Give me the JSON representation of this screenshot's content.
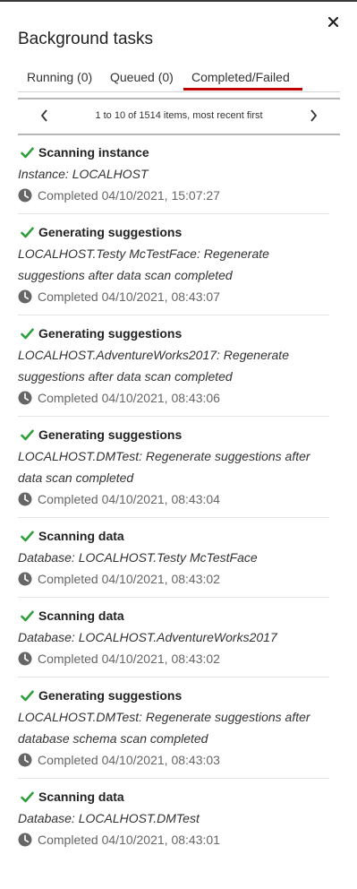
{
  "panel": {
    "title": "Background tasks",
    "close_label": "×"
  },
  "tabs": [
    {
      "label": "Running (0)"
    },
    {
      "label": "Queued (0)"
    },
    {
      "label": "Completed/Failed",
      "active": true
    }
  ],
  "pager": {
    "info": "1 to 10 of 1514 items, most recent first",
    "prev_icon": "chevron-left-icon",
    "next_icon": "chevron-right-icon"
  },
  "colors": {
    "accent": "#c00000",
    "success": "#2e9e3a",
    "muted": "#666666"
  },
  "tasks": [
    {
      "title": "Scanning instance",
      "desc": "Instance: LOCALHOST",
      "status": "Completed 04/10/2021, 15:07:27"
    },
    {
      "title": "Generating suggestions",
      "desc": "LOCALHOST.Testy McTestFace: Regenerate suggestions after data scan completed",
      "status": "Completed 04/10/2021, 08:43:07"
    },
    {
      "title": "Generating suggestions",
      "desc": "LOCALHOST.AdventureWorks2017: Regenerate suggestions after data scan completed",
      "status": "Completed 04/10/2021, 08:43:06"
    },
    {
      "title": "Generating suggestions",
      "desc": "LOCALHOST.DMTest: Regenerate suggestions after data scan completed",
      "status": "Completed 04/10/2021, 08:43:04"
    },
    {
      "title": "Scanning data",
      "desc": "Database: LOCALHOST.Testy McTestFace",
      "status": "Completed 04/10/2021, 08:43:02"
    },
    {
      "title": "Scanning data",
      "desc": "Database: LOCALHOST.AdventureWorks2017",
      "status": "Completed 04/10/2021, 08:43:02"
    },
    {
      "title": "Generating suggestions",
      "desc": "LOCALHOST.DMTest: Regenerate suggestions after database schema scan completed",
      "status": "Completed 04/10/2021, 08:43:03"
    },
    {
      "title": "Scanning data",
      "desc": "Database: LOCALHOST.DMTest",
      "status": "Completed 04/10/2021, 08:43:01"
    }
  ]
}
